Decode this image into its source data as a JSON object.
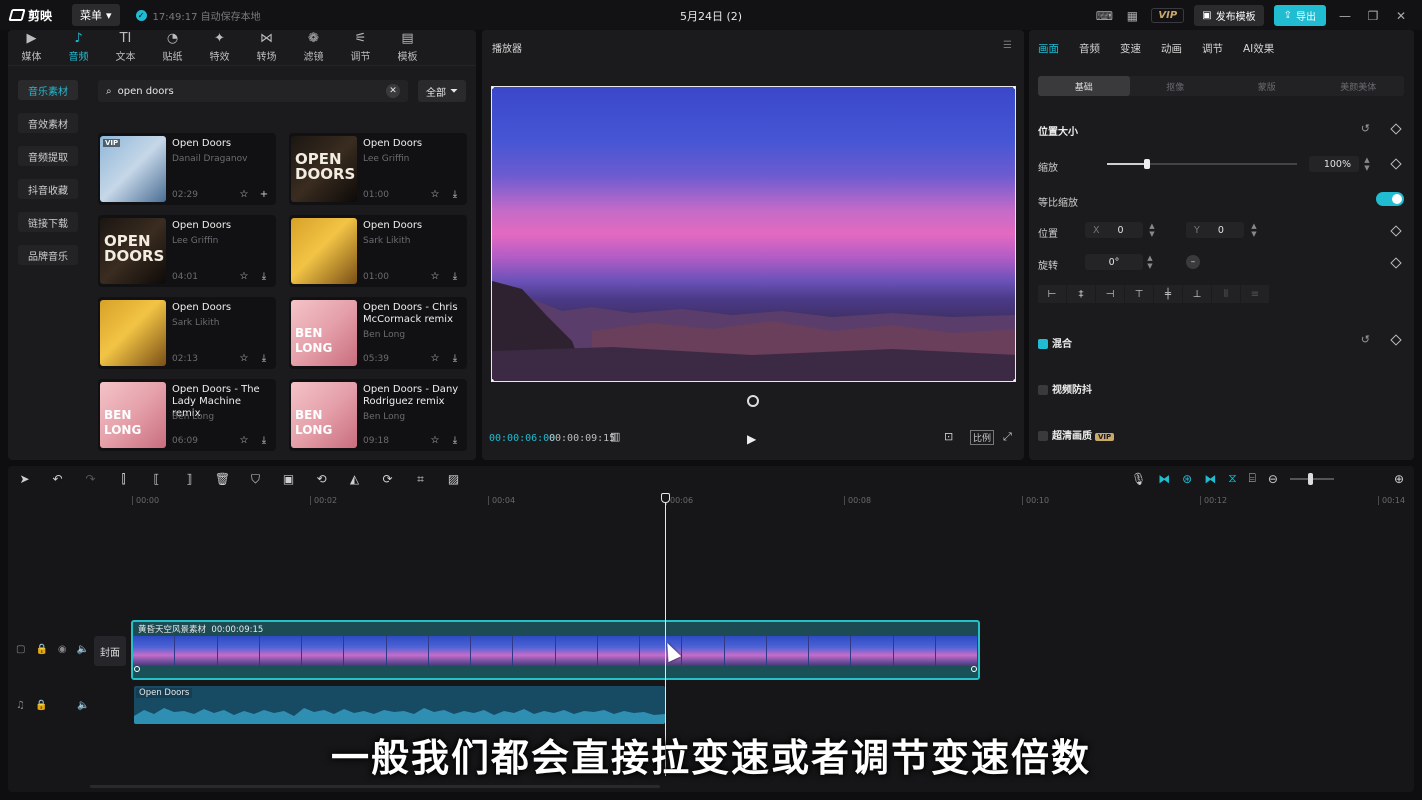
{
  "app": {
    "name": "剪映",
    "menu_label": "菜单",
    "autosave": "17:49:17 自动保存本地",
    "title": "5月24日 (2)",
    "vip": "VIP",
    "publish": "发布模板",
    "export": "导出"
  },
  "media_tabs": [
    {
      "label": "媒体",
      "icon": "media-icon"
    },
    {
      "label": "音频",
      "icon": "audio-icon"
    },
    {
      "label": "文本",
      "icon": "text-icon"
    },
    {
      "label": "贴纸",
      "icon": "sticker-icon"
    },
    {
      "label": "特效",
      "icon": "effects-icon"
    },
    {
      "label": "转场",
      "icon": "transition-icon"
    },
    {
      "label": "滤镜",
      "icon": "filter-icon"
    },
    {
      "label": "调节",
      "icon": "adjust-icon"
    },
    {
      "label": "模板",
      "icon": "template-icon"
    }
  ],
  "audio_nav": [
    "音乐素材",
    "音效素材",
    "音频提取",
    "抖音收藏",
    "链接下载",
    "品牌音乐"
  ],
  "search": {
    "value": "open doors",
    "filter": "全部"
  },
  "music": [
    {
      "title": "Open Doors",
      "artist": "Danail Draganov",
      "duration": "02:29"
    },
    {
      "title": "Open Doors",
      "artist": "Lee Griffin",
      "duration": "01:00"
    },
    {
      "title": "Open Doors",
      "artist": "Lee Griffin",
      "duration": "04:01"
    },
    {
      "title": "Open Doors",
      "artist": "Sark Likith",
      "duration": "01:00"
    },
    {
      "title": "Open Doors",
      "artist": "Sark Likith",
      "duration": "02:13"
    },
    {
      "title": "Open Doors - Chris McCormack remix",
      "artist": "Ben Long",
      "duration": "05:39"
    },
    {
      "title": "Open Doors - The Lady Machine remix",
      "artist": "Ben Long",
      "duration": "06:09"
    },
    {
      "title": "Open Doors - Dany Rodriguez remix",
      "artist": "Ben Long",
      "duration": "09:18"
    }
  ],
  "covers": {
    "vip": "VIP",
    "open_doors": "OPEN DOORS",
    "ben_long": "BEN LONG"
  },
  "player": {
    "title": "播放器",
    "current_time": "00:00:06:00",
    "total_time": "00:00:09:15",
    "ratio": "比例"
  },
  "inspector": {
    "tabs": [
      "画面",
      "音频",
      "变速",
      "动画",
      "调节",
      "AI效果"
    ],
    "subtabs": [
      "基础",
      "抠像",
      "蒙版",
      "美颜美体"
    ],
    "position_size": "位置大小",
    "scale_label": "缩放",
    "scale_value": "100%",
    "uniform_scale": "等比缩放",
    "position_label": "位置",
    "x_label": "X",
    "x_value": "0",
    "y_label": "Y",
    "y_value": "0",
    "rotate_label": "旋转",
    "rotate_value": "0°",
    "blend": "混合",
    "stabilize": "视频防抖",
    "hd": "超清画质",
    "hd_badge": "VIP"
  },
  "timeline": {
    "ticks": [
      "00:00",
      "00:02",
      "00:04",
      "00:06",
      "00:08",
      "00:10",
      "00:12",
      "00:14"
    ],
    "cover": "封面",
    "video_clip": {
      "name": "黄昏天空风景素材",
      "duration": "00:00:09:15"
    },
    "audio_clip": {
      "name": "Open Doors"
    },
    "playhead_time": "00:06"
  },
  "subtitle": "一般我们都会直接拉变速或者调节变速倍数",
  "colors": {
    "accent": "#1fbcd2",
    "vip": "#c9a868"
  }
}
